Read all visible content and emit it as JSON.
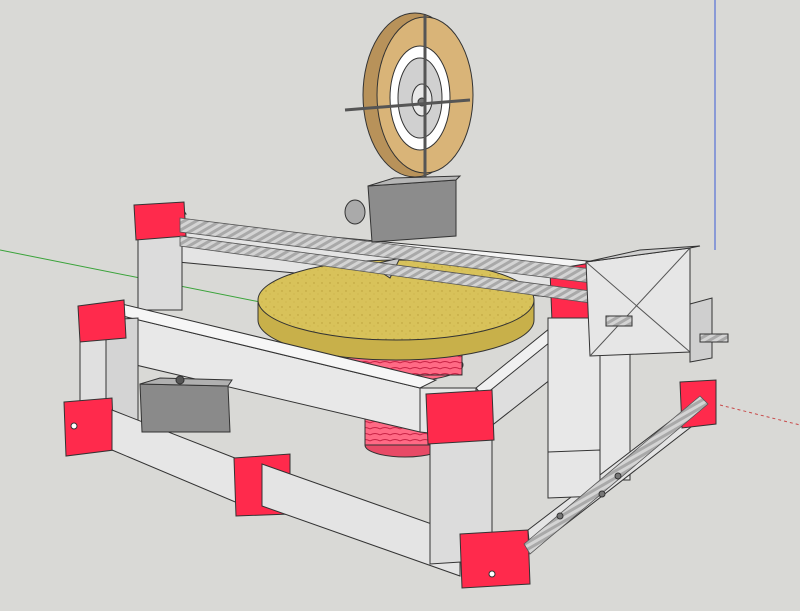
{
  "viewport": {
    "background": "#d9d9d6",
    "axes": {
      "green_axis": "#3aa33a",
      "blue_axis": "#3b5bd6",
      "red_axis": "#c84a4a"
    }
  },
  "model": {
    "frame_color": "#e6e6e6",
    "corner_color": "#ff2a4c",
    "screw_rod_color": "#c8c8c8",
    "motor_color": "#8c8c8c",
    "turntable_color": "#d9c256",
    "spring_color": "#ff4a6a",
    "wheel_rim_color": "#b8925a"
  }
}
